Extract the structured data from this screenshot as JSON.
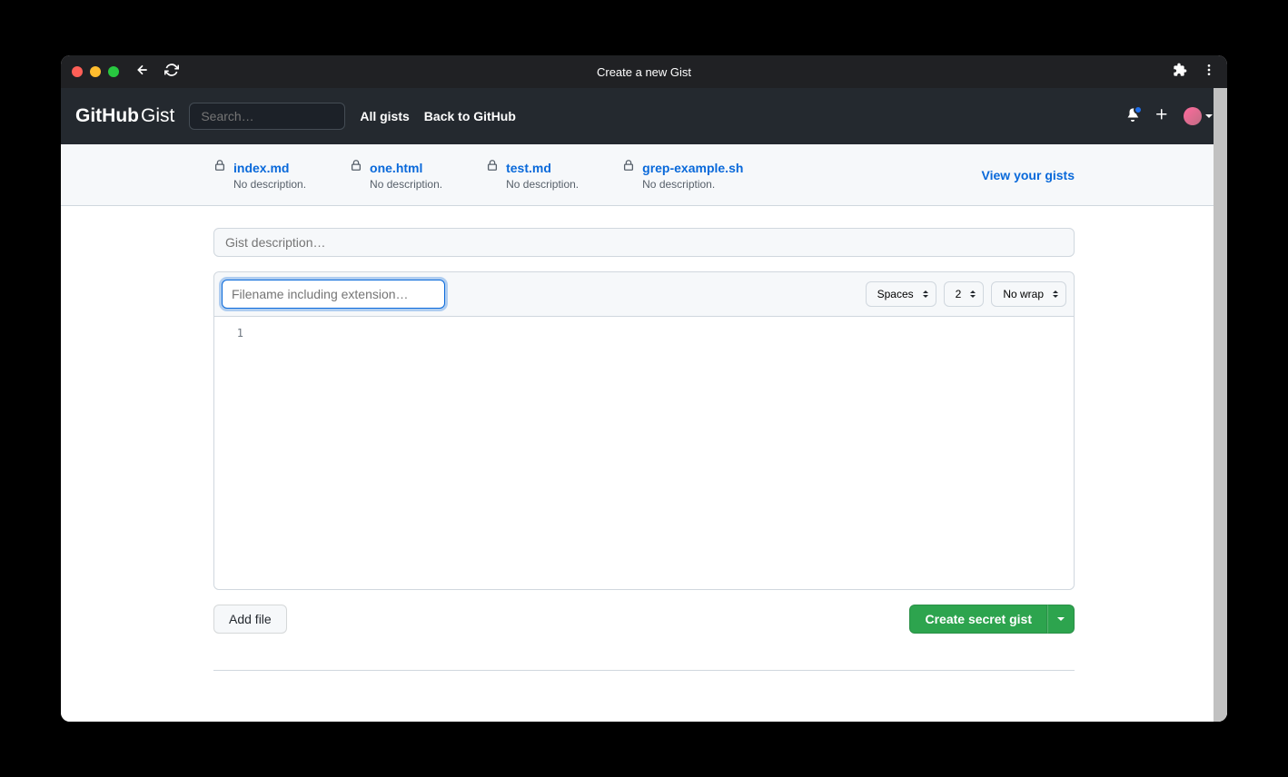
{
  "browser": {
    "tab_title": "Create a new Gist"
  },
  "header": {
    "logo_github": "GitHub",
    "logo_gist": "Gist",
    "search_placeholder": "Search…",
    "links": [
      "All gists",
      "Back to GitHub"
    ]
  },
  "recent_gists": [
    {
      "name": "index.md",
      "description": "No description."
    },
    {
      "name": "one.html",
      "description": "No description."
    },
    {
      "name": "test.md",
      "description": "No description."
    },
    {
      "name": "grep-example.sh",
      "description": "No description."
    }
  ],
  "view_gists_label": "View your gists",
  "editor": {
    "description_placeholder": "Gist description…",
    "filename_placeholder": "Filename including extension…",
    "indent_mode": "Spaces",
    "indent_size": "2",
    "wrap_mode": "No wrap",
    "line_number": "1"
  },
  "actions": {
    "add_file_label": "Add file",
    "create_label": "Create secret gist"
  }
}
